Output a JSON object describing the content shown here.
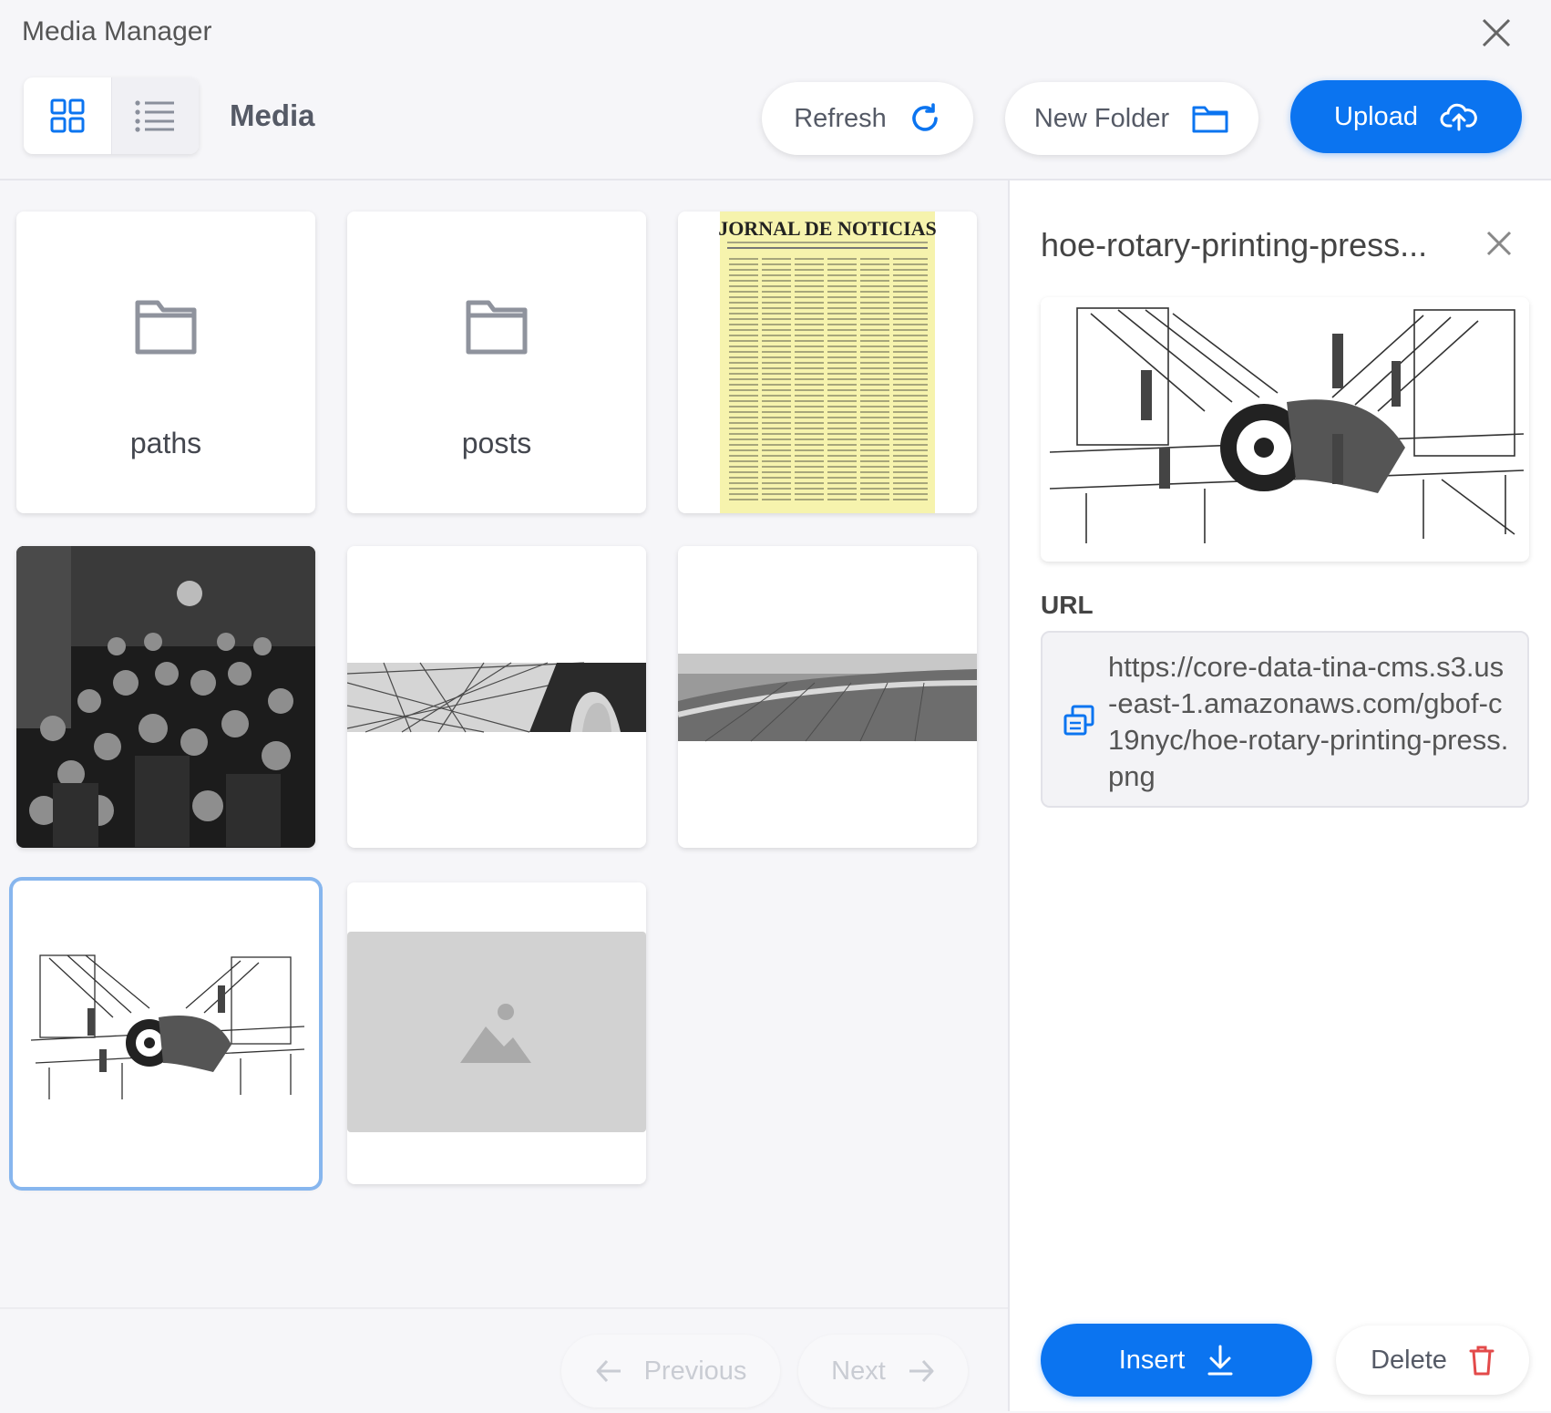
{
  "window": {
    "title": "Media Manager"
  },
  "toolbar": {
    "breadcrumb": "Media",
    "refresh_label": "Refresh",
    "new_folder_label": "New Folder",
    "upload_label": "Upload",
    "accent_color": "#0b74f0"
  },
  "grid": {
    "folders": [
      {
        "label": "paths"
      },
      {
        "label": "posts"
      }
    ],
    "newspaper_headline": "JORNAL DE NOTICIAS"
  },
  "pagination": {
    "previous_label": "Previous",
    "next_label": "Next"
  },
  "detail": {
    "filename": "hoe-rotary-printing-press...",
    "url_label": "URL",
    "url": "https://core-data-tina-cms.s3.us-east-1.amazonaws.com/gbof-c19nyc/hoe-rotary-printing-press.png",
    "insert_label": "Insert",
    "delete_label": "Delete"
  }
}
